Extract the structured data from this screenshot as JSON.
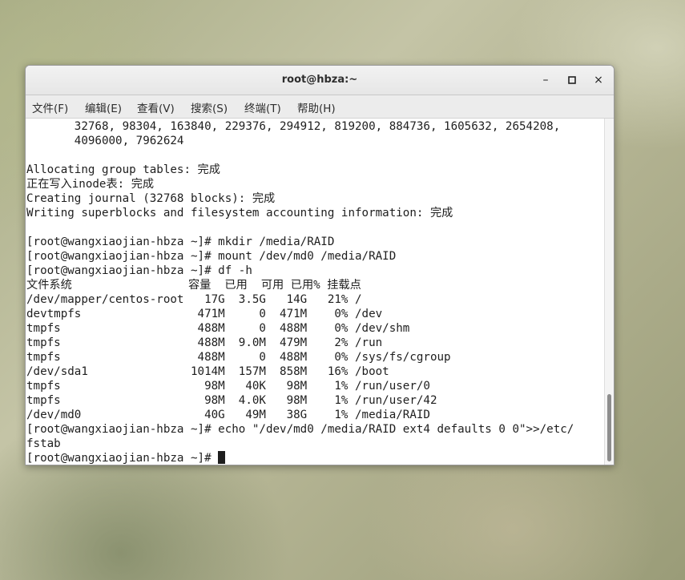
{
  "window": {
    "title": "root@hbza:~"
  },
  "controls": {
    "minimize": "–",
    "maximize": "□",
    "close": "×"
  },
  "menu": [
    {
      "label": "文件(F)"
    },
    {
      "label": "编辑(E)"
    },
    {
      "label": "查看(V)"
    },
    {
      "label": "搜索(S)"
    },
    {
      "label": "终端(T)"
    },
    {
      "label": "帮助(H)"
    }
  ],
  "terminal": {
    "lines": [
      "       32768, 98304, 163840, 229376, 294912, 819200, 884736, 1605632, 2654208,",
      "       4096000, 7962624",
      "",
      "Allocating group tables: 完成",
      "正在写入inode表: 完成",
      "Creating journal (32768 blocks): 完成",
      "Writing superblocks and filesystem accounting information: 完成",
      "",
      "[root@wangxiaojian-hbza ~]# mkdir /media/RAID",
      "[root@wangxiaojian-hbza ~]# mount /dev/md0 /media/RAID",
      "[root@wangxiaojian-hbza ~]# df -h",
      "文件系统                 容量  已用  可用 已用% 挂载点",
      "/dev/mapper/centos-root   17G  3.5G   14G   21% /",
      "devtmpfs                 471M     0  471M    0% /dev",
      "tmpfs                    488M     0  488M    0% /dev/shm",
      "tmpfs                    488M  9.0M  479M    2% /run",
      "tmpfs                    488M     0  488M    0% /sys/fs/cgroup",
      "/dev/sda1               1014M  157M  858M   16% /boot",
      "tmpfs                     98M   40K   98M    1% /run/user/0",
      "tmpfs                     98M  4.0K   98M    1% /run/user/42",
      "/dev/md0                  40G   49M   38G    1% /media/RAID",
      "[root@wangxiaojian-hbza ~]# echo \"/dev/md0 /media/RAID ext4 defaults 0 0\">>/etc/",
      "fstab"
    ],
    "prompt": "[root@wangxiaojian-hbza ~]# "
  }
}
